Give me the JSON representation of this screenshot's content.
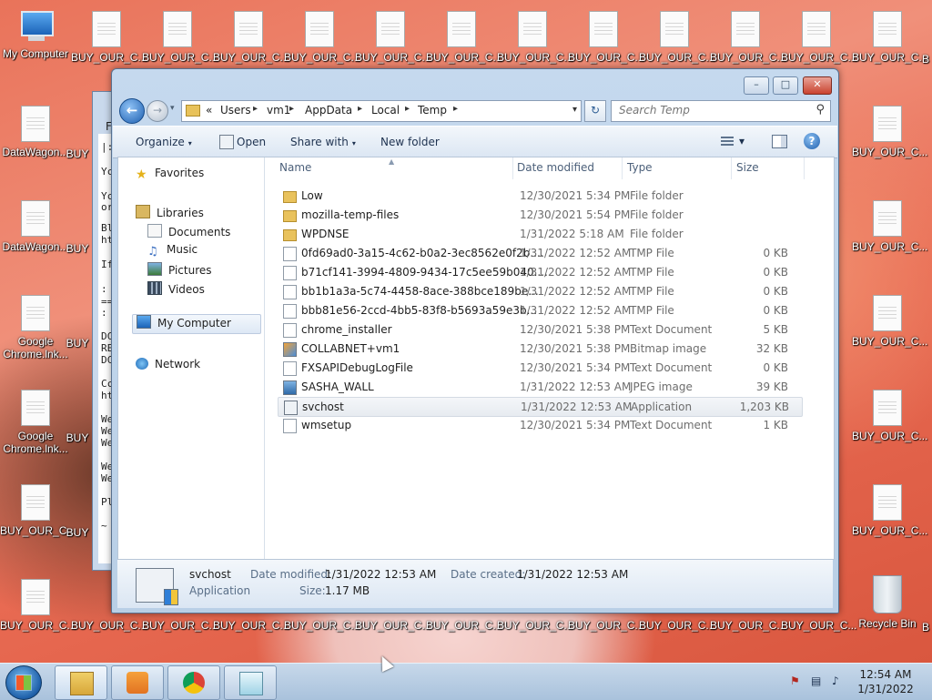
{
  "desktop": {
    "icons": [
      {
        "label": "My Computer",
        "kind": "computer"
      },
      {
        "label": "BUY_OUR_C...",
        "kind": "doc"
      },
      {
        "label": "DataWagon...",
        "kind": "doc"
      },
      {
        "label": "Google Chrome.lnk...",
        "kind": "doc"
      },
      {
        "label": "Recycle Bin",
        "kind": "bin"
      }
    ],
    "col2_labels": [
      "BUY",
      "BUY",
      "BUY",
      "BUY",
      "BUY",
      "BUY"
    ],
    "right_edge_label": "B"
  },
  "back_window": {
    "title_char": "F",
    "lines": [
      "|:",
      "Yc",
      "Yc",
      "or",
      "Bl",
      "ht",
      "If",
      ":",
      "==",
      ":",
      "DC",
      "RE",
      "DC",
      "Cc",
      "ht",
      "We",
      "We",
      "We",
      "We",
      "We",
      "Pl",
      "~"
    ]
  },
  "explorer": {
    "nav": {
      "back": "←",
      "forward": "→",
      "history": "▾"
    },
    "address": {
      "prefix": "«",
      "crumbs": [
        "Users",
        "vm1",
        "AppData",
        "Local",
        "Temp"
      ],
      "separator": "▸",
      "dropdown": "▾"
    },
    "refresh": "↻",
    "search": {
      "placeholder": "Search Temp",
      "value": ""
    },
    "toolbar": {
      "organize": "Organize",
      "open": "Open",
      "share_with": "Share with",
      "new_folder": "New folder",
      "caret": "▾",
      "help": "?"
    },
    "window_controls": {
      "minimize": "–",
      "maximize": "□",
      "close": "✕"
    },
    "nav_pane": {
      "favorites": "Favorites",
      "libraries": "Libraries",
      "documents": "Documents",
      "music": "Music",
      "pictures": "Pictures",
      "videos": "Videos",
      "computer": "My Computer",
      "network": "Network"
    },
    "columns": {
      "name": "Name",
      "date": "Date modified",
      "type": "Type",
      "size": "Size"
    },
    "files": [
      {
        "name": "Low",
        "date": "12/30/2021 5:34 PM",
        "type": "File folder",
        "size": "",
        "icon": "folder"
      },
      {
        "name": "mozilla-temp-files",
        "date": "12/30/2021 5:54 PM",
        "type": "File folder",
        "size": "",
        "icon": "folder"
      },
      {
        "name": "WPDNSE",
        "date": "1/31/2022 5:18 AM",
        "type": "File folder",
        "size": "",
        "icon": "folder"
      },
      {
        "name": "0fd69ad0-3a15-4c62-b0a2-3ec8562e0f2b....",
        "date": "1/31/2022 12:52 AM",
        "type": "TMP File",
        "size": "0 KB",
        "icon": "file"
      },
      {
        "name": "b71cf141-3994-4809-9434-17c5ee59b040....",
        "date": "1/31/2022 12:52 AM",
        "type": "TMP File",
        "size": "0 KB",
        "icon": "file"
      },
      {
        "name": "bb1b1a3a-5c74-4458-8ace-388bce189be...",
        "date": "1/31/2022 12:52 AM",
        "type": "TMP File",
        "size": "0 KB",
        "icon": "file"
      },
      {
        "name": "bbb81e56-2ccd-4bb5-83f8-b5693a59e3b...",
        "date": "1/31/2022 12:52 AM",
        "type": "TMP File",
        "size": "0 KB",
        "icon": "file"
      },
      {
        "name": "chrome_installer",
        "date": "12/30/2021 5:38 PM",
        "type": "Text Document",
        "size": "5 KB",
        "icon": "file"
      },
      {
        "name": "COLLABNET+vm1",
        "date": "12/30/2021 5:38 PM",
        "type": "Bitmap image",
        "size": "32 KB",
        "icon": "bmp"
      },
      {
        "name": "FXSAPIDebugLogFile",
        "date": "12/30/2021 5:34 PM",
        "type": "Text Document",
        "size": "0 KB",
        "icon": "file"
      },
      {
        "name": "SASHA_WALL",
        "date": "1/31/2022 12:53 AM",
        "type": "JPEG image",
        "size": "39 KB",
        "icon": "jpg"
      },
      {
        "name": "svchost",
        "date": "1/31/2022 12:53 AM",
        "type": "Application",
        "size": "1,203 KB",
        "icon": "app",
        "selected": true
      },
      {
        "name": "wmsetup",
        "date": "12/30/2021 5:34 PM",
        "type": "Text Document",
        "size": "1 KB",
        "icon": "file"
      }
    ],
    "details": {
      "name": "svchost",
      "type": "Application",
      "modified_label": "Date modified:",
      "modified": "1/31/2022 12:53 AM",
      "created_label": "Date created:",
      "created": "1/31/2022 12:53 AM",
      "size_label": "Size:",
      "size": "1.17 MB"
    }
  },
  "taskbar": {
    "clock_time": "12:54 AM",
    "clock_date": "1/31/2022",
    "tray": {
      "flag": "⚑",
      "network": "▤",
      "volume": "♪"
    }
  }
}
